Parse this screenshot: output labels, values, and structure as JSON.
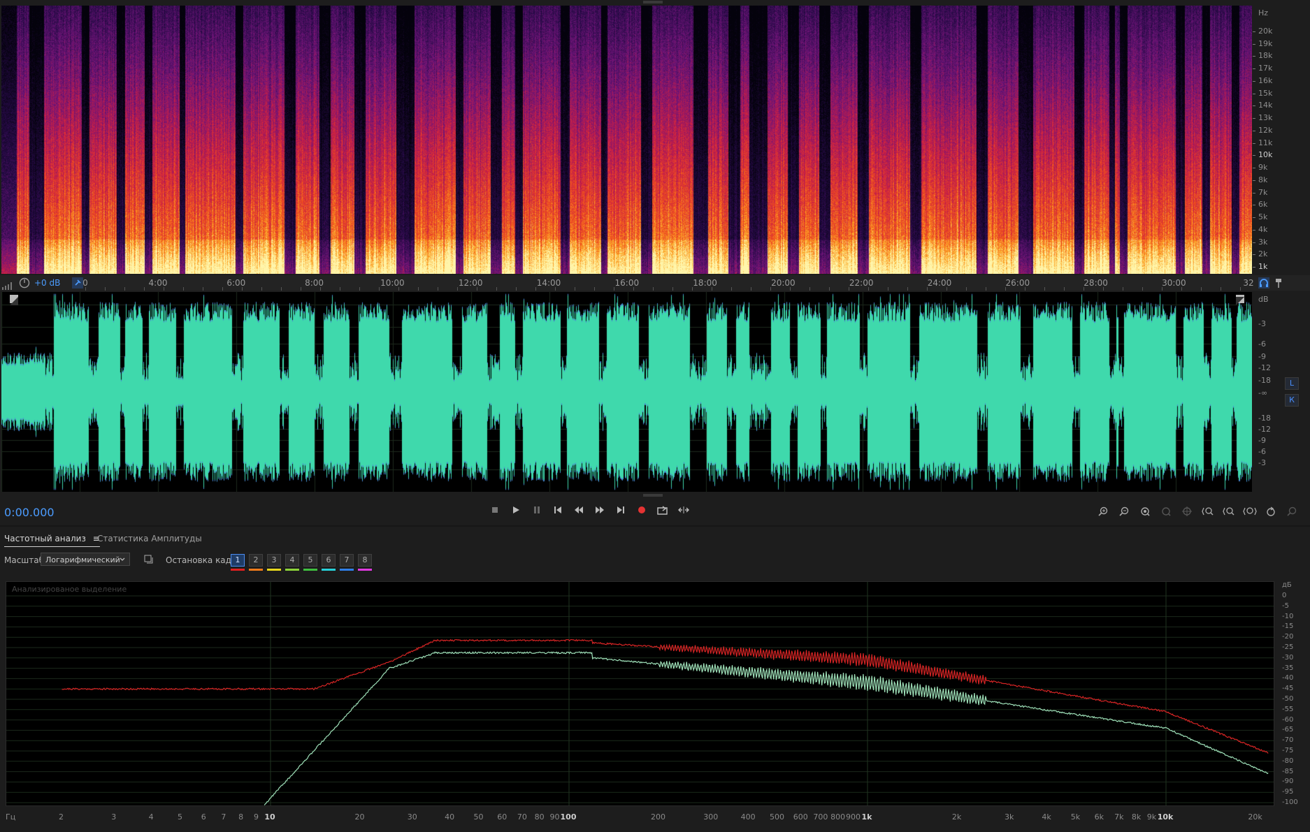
{
  "spectrogram": {
    "unit_label": "Hz",
    "freq_labels": [
      "20k",
      "19k",
      "18k",
      "17k",
      "16k",
      "15k",
      "14k",
      "13k",
      "12k",
      "11k",
      "10k",
      "9k",
      "8k",
      "7k",
      "6k",
      "5k",
      "4k",
      "3k",
      "2k",
      "1k"
    ],
    "bold_labels": [
      "10k",
      "1k"
    ]
  },
  "timeline": {
    "level_label": "+0 dB",
    "start_label": "0",
    "labels": [
      "4:00",
      "6:00",
      "8:00",
      "10:00",
      "12:00",
      "14:00",
      "16:00",
      "18:00",
      "20:00",
      "22:00",
      "24:00",
      "26:00",
      "28:00",
      "30:00",
      "32"
    ]
  },
  "waveform": {
    "unit_label": "dB",
    "db_labels": [
      "-3",
      "-6",
      "-9",
      "-12",
      "-18",
      "-∞",
      "-18",
      "-12",
      "-9",
      "-6",
      "-3"
    ],
    "channel_left": "L",
    "channel_right": "К",
    "color": "#3fd9ac"
  },
  "transport": {
    "timecode": "0:00.000"
  },
  "panel": {
    "tab_frequency": "Частотный анализ",
    "tab_menu_glyph": "≡",
    "tab_amplitude": "Статистика Амплитуды",
    "scale_label": "Масштаб:",
    "scale_value": "Логарифмический",
    "freeze_label": "Остановка кадра:",
    "freeze_buttons": [
      "1",
      "2",
      "3",
      "4",
      "5",
      "6",
      "7",
      "8"
    ],
    "freeze_colors": [
      "#e02020",
      "#f07a1a",
      "#e8d81c",
      "#8cd33a",
      "#3fbf3f",
      "#27d0d8",
      "#2f7fe8",
      "#e03ae0"
    ],
    "overlay_text": "Анализированое выделение",
    "db_unit": "дБ",
    "db_labels": [
      "0",
      "-5",
      "-10",
      "-15",
      "-20",
      "-25",
      "-30",
      "-35",
      "-40",
      "-45",
      "-50",
      "-55",
      "-60",
      "-65",
      "-70",
      "-75",
      "-80",
      "-85",
      "-90",
      "-95",
      "-100"
    ],
    "hz_unit": "Гц",
    "hz_labels": [
      "2",
      "3",
      "4",
      "5",
      "6",
      "7",
      "8",
      "9",
      "10",
      "20",
      "30",
      "40",
      "50",
      "60",
      "70",
      "80",
      "90",
      "100",
      "200",
      "300",
      "400",
      "500",
      "600",
      "700",
      "800",
      "900",
      "1k",
      "2k",
      "3k",
      "4k",
      "5k",
      "6k",
      "7k",
      "8k",
      "9k",
      "10k",
      "20k"
    ],
    "hz_bold": [
      "10",
      "100",
      "1k",
      "10k"
    ],
    "curve_colors": {
      "red": "#d42424",
      "green": "#9ee0b8"
    }
  }
}
